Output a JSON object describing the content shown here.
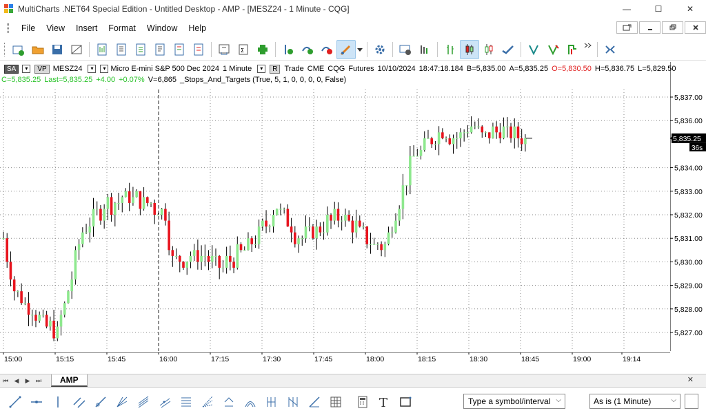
{
  "window": {
    "title": "MultiCharts .NET64 Special Edition - Untitled Desktop - AMP - [MESZ24 - 1 Minute - CQG]",
    "minimize": "—",
    "maximize": "☐",
    "close": "✕"
  },
  "menu": {
    "items": [
      {
        "label": "File",
        "name": "menu-file"
      },
      {
        "label": "View",
        "name": "menu-view"
      },
      {
        "label": "Insert",
        "name": "menu-insert"
      },
      {
        "label": "Format",
        "name": "menu-format"
      },
      {
        "label": "Window",
        "name": "menu-window"
      },
      {
        "label": "Help",
        "name": "menu-help"
      }
    ]
  },
  "status": {
    "tag_sa": "SA",
    "tag_vp": "VP",
    "symbol": "MESZ24",
    "description": "Micro E-mini S&P 500 Dec 2024",
    "interval": "1 Minute",
    "tag_r": "R",
    "mode": "Trade",
    "exchange": "CME",
    "feed": "CQG",
    "category": "Futures",
    "date": "10/10/2024",
    "time": "18:47:18.184",
    "bid": "B=5,835.00",
    "ask": "A=5,835.25",
    "open": "O=5,830.50",
    "high": "H=5,836.75",
    "low": "L=5,829.50",
    "close": "C=5,835.25",
    "last": "Last=5,835.25",
    "change": "+4.00",
    "change_pct": "+0.07%",
    "volume": "V=6,865",
    "strategy": "_Stops_And_Targets (True, 5, 1, 0, 0, 0, 0, False)"
  },
  "price_axis": {
    "labels": [
      "5,837.00",
      "5,836.00",
      "5,834.00",
      "5,833.00",
      "5,832.00",
      "5,831.00",
      "5,830.00",
      "5,829.00",
      "5,828.00",
      "5,827.00"
    ],
    "current_price": "5,835.25",
    "countdown": "36s"
  },
  "time_axis": {
    "labels": [
      "15:00",
      "15:15",
      "15:45",
      "16:00",
      "17:15",
      "17:30",
      "17:45",
      "18:00",
      "18:15",
      "18:30",
      "18:45",
      "19:00",
      "19:14"
    ]
  },
  "chart_data": {
    "type": "candlestick",
    "ylim": [
      5826.5,
      5837.25
    ],
    "bar_count": 146,
    "session_break_index": 45,
    "bullish_color": "#8ee88e",
    "bearish_color": "#e8141e",
    "wick_color": "#000000"
  },
  "colors": {
    "accent": "#cde4f7",
    "price_box": "#000000",
    "grid": "#9a9a9a"
  },
  "tabs": {
    "nav_first": "⏮",
    "nav_prev": "◀",
    "nav_next": "▶",
    "nav_last": "⏭",
    "active": "AMP",
    "close": "✕"
  },
  "bottom": {
    "symbol_placeholder": "Type a symbol/interval",
    "resolution": "As is (1 Minute)"
  }
}
